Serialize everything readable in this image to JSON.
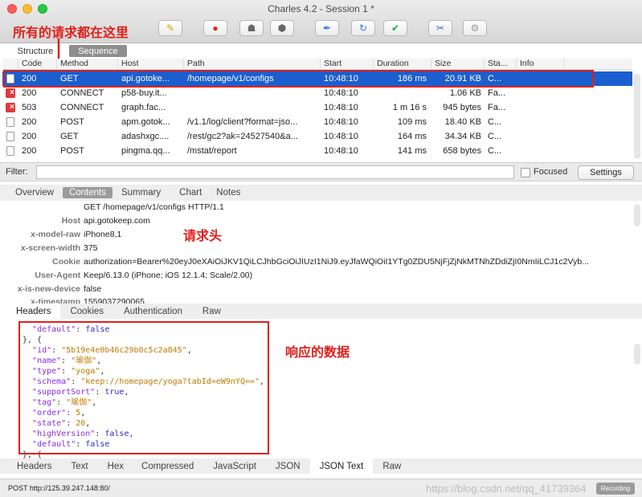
{
  "window": {
    "title": "Charles 4.2 - Session 1 *"
  },
  "toolbar": {
    "buttons": [
      {
        "icon": "broom-icon",
        "glyph": "✎"
      },
      {
        "icon": "record-icon",
        "glyph": "●"
      },
      {
        "icon": "throttle-turtle-icon",
        "glyph": "☗"
      },
      {
        "icon": "breakpoint-hexagon-icon",
        "glyph": "⬢"
      },
      {
        "icon": "compose-pen-icon",
        "glyph": "✒"
      },
      {
        "icon": "repeat-icon",
        "glyph": "↻"
      },
      {
        "icon": "validate-check-icon",
        "glyph": "✔"
      },
      {
        "icon": "tools-icon",
        "glyph": "✂"
      },
      {
        "icon": "settings-gear-icon",
        "glyph": "⚙"
      }
    ]
  },
  "annotations": {
    "all_requests": "所有的请求都在这里",
    "request_header": "请求头",
    "response_data": "响应的数据"
  },
  "view_tabs": {
    "structure": "Structure",
    "sequence": "Sequence"
  },
  "table": {
    "columns": [
      "Code",
      "Method",
      "Host",
      "Path",
      "Start",
      "Duration",
      "Size",
      "Sta...",
      "Info"
    ],
    "rows": [
      {
        "icon": "doc",
        "code": "200",
        "method": "GET",
        "host": "api.gotoke...",
        "path": "/homepage/v1/configs",
        "start": "10:48:10",
        "duration": "186 ms",
        "size": "20.91 KB",
        "status": "C..."
      },
      {
        "icon": "err",
        "code": "200",
        "method": "CONNECT",
        "host": "p58-buy.it...",
        "path": "",
        "start": "10:48:10",
        "duration": "",
        "size": "1.06 KB",
        "status": "Fa..."
      },
      {
        "icon": "err",
        "code": "503",
        "method": "CONNECT",
        "host": "graph.fac...",
        "path": "",
        "start": "10:48:10",
        "duration": "1 m 16 s",
        "size": "945 bytes",
        "status": "Fa..."
      },
      {
        "icon": "doc",
        "code": "200",
        "method": "POST",
        "host": "apm.gotok...",
        "path": "/v1.1/log/client?format=jso...",
        "start": "10:48:10",
        "duration": "109 ms",
        "size": "18.40 KB",
        "status": "C..."
      },
      {
        "icon": "doc",
        "code": "200",
        "method": "GET",
        "host": "adashxgc....",
        "path": "/rest/gc2?ak=24527540&a...",
        "start": "10:48:10",
        "duration": "164 ms",
        "size": "34.34 KB",
        "status": "C..."
      },
      {
        "icon": "doc",
        "code": "200",
        "method": "POST",
        "host": "pingma.qq...",
        "path": "/mstat/report",
        "start": "10:48:10",
        "duration": "141 ms",
        "size": "658 bytes",
        "status": "C..."
      }
    ]
  },
  "filter": {
    "label": "Filter:",
    "value": "",
    "focused_label": "Focused",
    "settings_label": "Settings"
  },
  "detail_tabs": [
    "Overview",
    "Contents",
    "Summary",
    "Chart",
    "Notes"
  ],
  "request": {
    "request_line": "GET /homepage/v1/configs HTTP/1.1",
    "headers": [
      {
        "name": "Host",
        "value": "api.gotokeep.com"
      },
      {
        "name": "x-model-raw",
        "value": "iPhone8,1"
      },
      {
        "name": "x-screen-width",
        "value": "375"
      },
      {
        "name": "Cookie",
        "value": "authorization=Bearer%20eyJ0eXAiOiJKV1QiLCJhbGciOiJIUzI1NiJ9.eyJfaWQiOiI1YTg0ZDU5NjFjZjNkMTNhZDdiZjI0NmIiLCJ1c2Vyb..."
      },
      {
        "name": "User-Agent",
        "value": "Keep/6.13.0 (iPhone; iOS 12.1.4; Scale/2.00)"
      },
      {
        "name": "x-is-new-device",
        "value": "false"
      },
      {
        "name": "x-timestamp",
        "value": "1559037290065"
      }
    ]
  },
  "request_tabs": [
    "Headers",
    "Cookies",
    "Authentication",
    "Raw"
  ],
  "response_tabs": [
    "Headers",
    "Text",
    "Hex",
    "Compressed",
    "JavaScript",
    "JSON",
    "JSON Text",
    "Raw"
  ],
  "response_json": {
    "l0_key": "\"default\"",
    "l0_val": "false",
    "l1": "}, {",
    "id_key": "\"id\"",
    "id_val": "\"5b19e4e0b46c29b0c5c2a845\"",
    "name_key": "\"name\"",
    "name_val": "\"瑜伽\"",
    "type_key": "\"type\"",
    "type_val": "\"yoga\"",
    "schema_key": "\"schema\"",
    "schema_val": "\"keep://homepage/yoga?tabId=eW9nYQ==\"",
    "support_key": "\"supportSort\"",
    "support_val": "true",
    "tag_key": "\"tag\"",
    "tag_val": "\"瑜伽\"",
    "order_key": "\"order\"",
    "order_val": "5",
    "state_key": "\"state\"",
    "state_val": "20",
    "hv_key": "\"highVersion\"",
    "hv_val": "false",
    "def_key": "\"default\"",
    "def_val": "false",
    "l_end": "}, {"
  },
  "status": {
    "text": "POST http://125.39.247.148:80/",
    "recording": "Recording",
    "watermark": "https://blog.csdn.net/qq_41739364"
  },
  "colors": {
    "selection": "#1b5ece",
    "annotation": "#e0201a"
  }
}
